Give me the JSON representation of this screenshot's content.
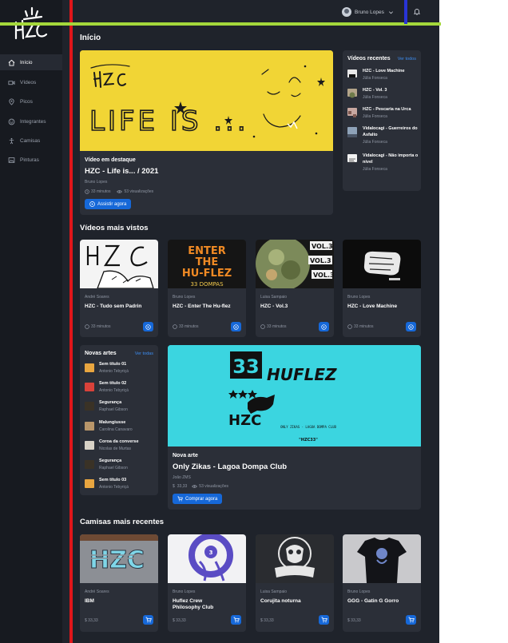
{
  "header": {
    "user_name": "Bruno Lopes"
  },
  "sidebar": {
    "items": [
      {
        "label": "Início",
        "icon": "home-icon"
      },
      {
        "label": "Vídeos",
        "icon": "video-icon"
      },
      {
        "label": "Picos",
        "icon": "map-pin-icon"
      },
      {
        "label": "Integrantes",
        "icon": "users-icon"
      },
      {
        "label": "Camisas",
        "icon": "shirt-icon"
      },
      {
        "label": "Pinturas",
        "icon": "image-icon"
      }
    ]
  },
  "page": {
    "title": "Início"
  },
  "featured": {
    "label": "Vídeo em destaque",
    "title": "HZC - Life is... / 2021",
    "author": "Bruno Lopes",
    "duration": "33 minutos",
    "views": "53 visualizações",
    "button": "Assistir agora",
    "image_text": "LIFE IS ..."
  },
  "recent_videos": {
    "title": "Vídeos recentes",
    "link": "Ver todos",
    "items": [
      {
        "title": "HZC - Love Machine",
        "author": "Júlia Fonseca"
      },
      {
        "title": "HZC - Vol. 3",
        "author": "Júlia Fonseca"
      },
      {
        "title": "HZC - Pescaria na Urca",
        "author": "Júlia Fonseca"
      },
      {
        "title": "Vidalocagi - Guerreiros do Asfalto",
        "author": "Júlia Fonseca"
      },
      {
        "title": "Vidalocagi - Não importa o nível",
        "author": "Júlia Fonseca"
      }
    ]
  },
  "most_viewed": {
    "title": "Vídeos mais vistos",
    "items": [
      {
        "author": "André Soares",
        "title": "HZC - Tudo sem Padrin",
        "duration": "33 minutos"
      },
      {
        "author": "Bruno Lopes",
        "title": "HZC - Enter The Hu-flez",
        "duration": "33 minutos"
      },
      {
        "author": "Luisa Sampaio",
        "title": "HZC - Vol.3",
        "duration": "33 minutos"
      },
      {
        "author": "Bruno Lopes",
        "title": "HZC - Love Machine",
        "duration": "33 minutos"
      }
    ]
  },
  "new_arts": {
    "title": "Novas artes",
    "link": "Ver todas",
    "items": [
      {
        "title": "Sem título 01",
        "author": "Antonio Tebyriçá"
      },
      {
        "title": "Sem título 02",
        "author": "Antonio Tebyriçá"
      },
      {
        "title": "Segurança",
        "author": "Raphael Gibson"
      },
      {
        "title": "Malungiusse",
        "author": "Carolina Canavaro"
      },
      {
        "title": "Coroa da converse",
        "author": "Nicolas de Murtas"
      },
      {
        "title": "Segurança",
        "author": "Raphael Gibson"
      },
      {
        "title": "Sem título 03",
        "author": "Antonio Tebyriçá"
      }
    ]
  },
  "featured_art": {
    "label": "Nova arte",
    "title": "Only Zikas - Lagoa Dompa Club",
    "author": "João ZMS",
    "price": "33,33",
    "views": "53 visualizações",
    "button": "Comprar agora",
    "image_text_1": "HUFLEZ",
    "image_text_2": "HZC",
    "image_text_3": "ONLY ZIKAS · LAGOA DOMPA CLUB",
    "image_text_4": "\"HZC33\""
  },
  "shirts": {
    "title": "Camisas mais recentes",
    "items": [
      {
        "author": "André Soares",
        "title": "IBM",
        "price": "33,33"
      },
      {
        "author": "Bruno Lopes",
        "title": "Huflez Crew Philosophy Club",
        "price": "33,33"
      },
      {
        "author": "Luisa Sampaio",
        "title": "Corujita noturna",
        "price": "33,33"
      },
      {
        "author": "Bruno Lopes",
        "title": "GGG - Gatin G Gorro",
        "price": "33,33"
      }
    ]
  },
  "colors": {
    "background": "#1f232b",
    "sidebar": "#171a20",
    "card": "#2b2f38",
    "accent": "#1668d8",
    "featured_yellow": "#f1d535",
    "featured_cyan": "#3bd5e0"
  }
}
